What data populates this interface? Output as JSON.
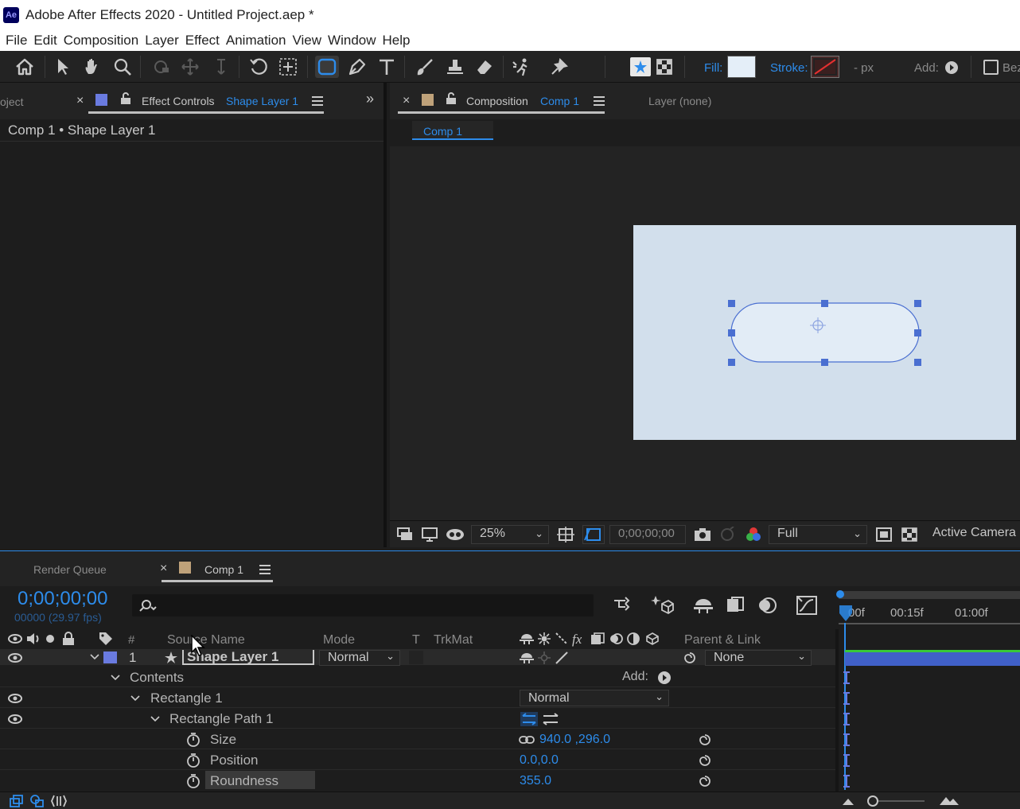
{
  "app": {
    "logo": "Ae",
    "title": "Adobe After Effects 2020 - Untitled Project.aep *"
  },
  "menu": [
    "File",
    "Edit",
    "Composition",
    "Layer",
    "Effect",
    "Animation",
    "View",
    "Window",
    "Help"
  ],
  "toolbar": {
    "fill_label": "Fill:",
    "stroke_label": "Stroke:",
    "stroke_width": "- px",
    "add_label": "Add:",
    "bezier_label": "Bez",
    "fill_color": "#e4eef8"
  },
  "left_panel": {
    "project_tab": "oject",
    "effect_controls_tab": "Effect Controls",
    "effect_controls_target": "Shape Layer 1",
    "breadcrumb": "Comp 1 • Shape Layer 1"
  },
  "comp_panel": {
    "tab_label": "Composition",
    "tab_target": "Comp 1",
    "layer_tab": "Layer (none)",
    "sub_tab": "Comp 1",
    "zoom": "25%",
    "timecode": "0;00;00;00",
    "resolution": "Full",
    "camera": "Active Camera",
    "canvas_color": "#d2dfec",
    "shape_fill": "#e2ecf6",
    "shape_stroke": "#4a6fd1"
  },
  "timeline": {
    "render_queue_tab": "Render Queue",
    "comp_tab": "Comp 1",
    "timecode": "0;00;00;00",
    "fps": "00000 (29.97 fps)",
    "ruler": [
      "00f",
      "00:15f",
      "01:00f"
    ],
    "headers": {
      "hash": "#",
      "source_name": "Source Name",
      "mode": "Mode",
      "t": "T",
      "trkmat": "TrkMat",
      "fx": "fx",
      "parent_link": "Parent & Link"
    },
    "layer": {
      "index": "1",
      "name": "Shape Layer 1",
      "mode": "Normal",
      "parent": "None"
    },
    "properties": {
      "contents": "Contents",
      "add_label": "Add:",
      "rectangle": "Rectangle 1",
      "rectangle_mode": "Normal",
      "rectangle_path": "Rectangle Path 1",
      "size_label": "Size",
      "size_value": "940.0 ,296.0",
      "position_label": "Position",
      "position_value": "0.0,0.0",
      "roundness_label": "Roundness",
      "roundness_value": "355.0"
    }
  }
}
